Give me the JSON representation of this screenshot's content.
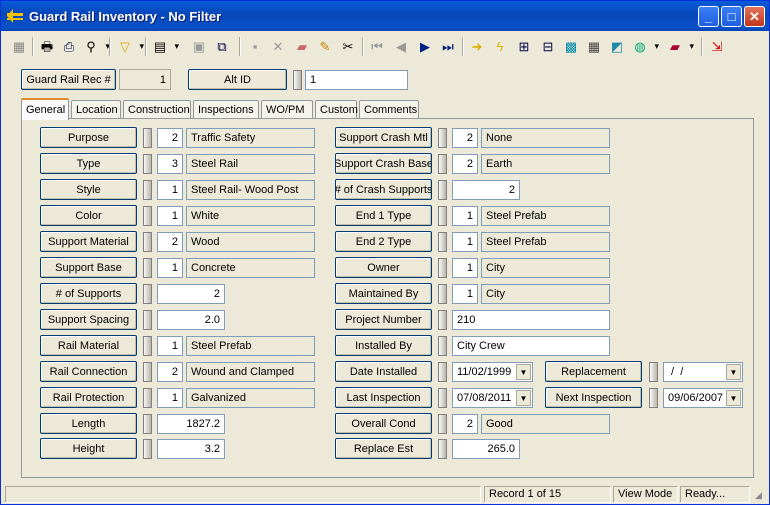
{
  "window": {
    "title": "Guard Rail Inventory - No Filter",
    "minimize": "_",
    "maximize": "□",
    "close": "✕"
  },
  "toolbar": {
    "icons": [
      "new-record",
      "print",
      "print-preview",
      "binoculars-find",
      "filter",
      "copy-record",
      "properties",
      "clone",
      "save",
      "delete",
      "attach-book",
      "edit-pencil",
      "cut-scissors",
      "first-record",
      "previous-record",
      "next-record",
      "last-record",
      "arrow-right",
      "lightning",
      "tree-view",
      "hierarchy",
      "map-layer",
      "calculator",
      "map",
      "globe",
      "book",
      "exit"
    ]
  },
  "header": {
    "rec_label": "Guard Rail Rec #",
    "rec_value": "1",
    "alt_id_label": "Alt ID",
    "alt_id_value": "1"
  },
  "tabs": [
    "General",
    "Location",
    "Construction",
    "Inspections",
    "WO/PM",
    "Custom",
    "Comments"
  ],
  "active_tab": "General",
  "left_fields": [
    {
      "label": "Purpose",
      "code": "2",
      "value": "Traffic Safety"
    },
    {
      "label": "Type",
      "code": "3",
      "value": "Steel Rail"
    },
    {
      "label": "Style",
      "code": "1",
      "value": "Steel Rail- Wood Post"
    },
    {
      "label": "Color",
      "code": "1",
      "value": "White"
    },
    {
      "label": "Support Material",
      "code": "2",
      "value": "Wood"
    },
    {
      "label": "Support Base",
      "code": "1",
      "value": "Concrete"
    },
    {
      "label": "# of Supports",
      "number": "2"
    },
    {
      "label": "Support Spacing",
      "number": "2.0"
    },
    {
      "label": "Rail Material",
      "code": "1",
      "value": "Steel Prefab"
    },
    {
      "label": "Rail Connection",
      "code": "2",
      "value": "Wound and Clamped"
    },
    {
      "label": "Rail Protection",
      "code": "1",
      "value": "Galvanized"
    },
    {
      "label": "Length",
      "number": "1827.2"
    },
    {
      "label": "Height",
      "number": "3.2"
    }
  ],
  "right_fields": [
    {
      "label": "Support Crash Mtl",
      "code": "2",
      "value": "None"
    },
    {
      "label": "Support Crash Base",
      "code": "2",
      "value": "Earth"
    },
    {
      "label": "# of Crash Supports",
      "number": "2"
    },
    {
      "label": "End 1 Type",
      "code": "1",
      "value": "Steel Prefab"
    },
    {
      "label": "End 2 Type",
      "code": "1",
      "value": "Steel Prefab"
    },
    {
      "label": "Owner",
      "code": "1",
      "value": "City"
    },
    {
      "label": "Maintained By",
      "code": "1",
      "value": "City"
    },
    {
      "label": "Project Number",
      "text": "210"
    },
    {
      "label": "Installed By",
      "text": "City Crew"
    },
    {
      "label": "Date Installed",
      "date": "11/02/1999"
    },
    {
      "label": "Last Inspection",
      "date": "07/08/2011"
    },
    {
      "label": "Overall Cond",
      "code": "2",
      "value": "Good"
    },
    {
      "label": "Replace Est",
      "number": "265.0"
    }
  ],
  "extra_fields": [
    {
      "label": "Replacement",
      "date": " /  /"
    },
    {
      "label": "Next Inspection",
      "date": "09/06/2007"
    }
  ],
  "status": {
    "record": "Record 1 of 15",
    "mode": "View Mode",
    "state": "Ready..."
  }
}
